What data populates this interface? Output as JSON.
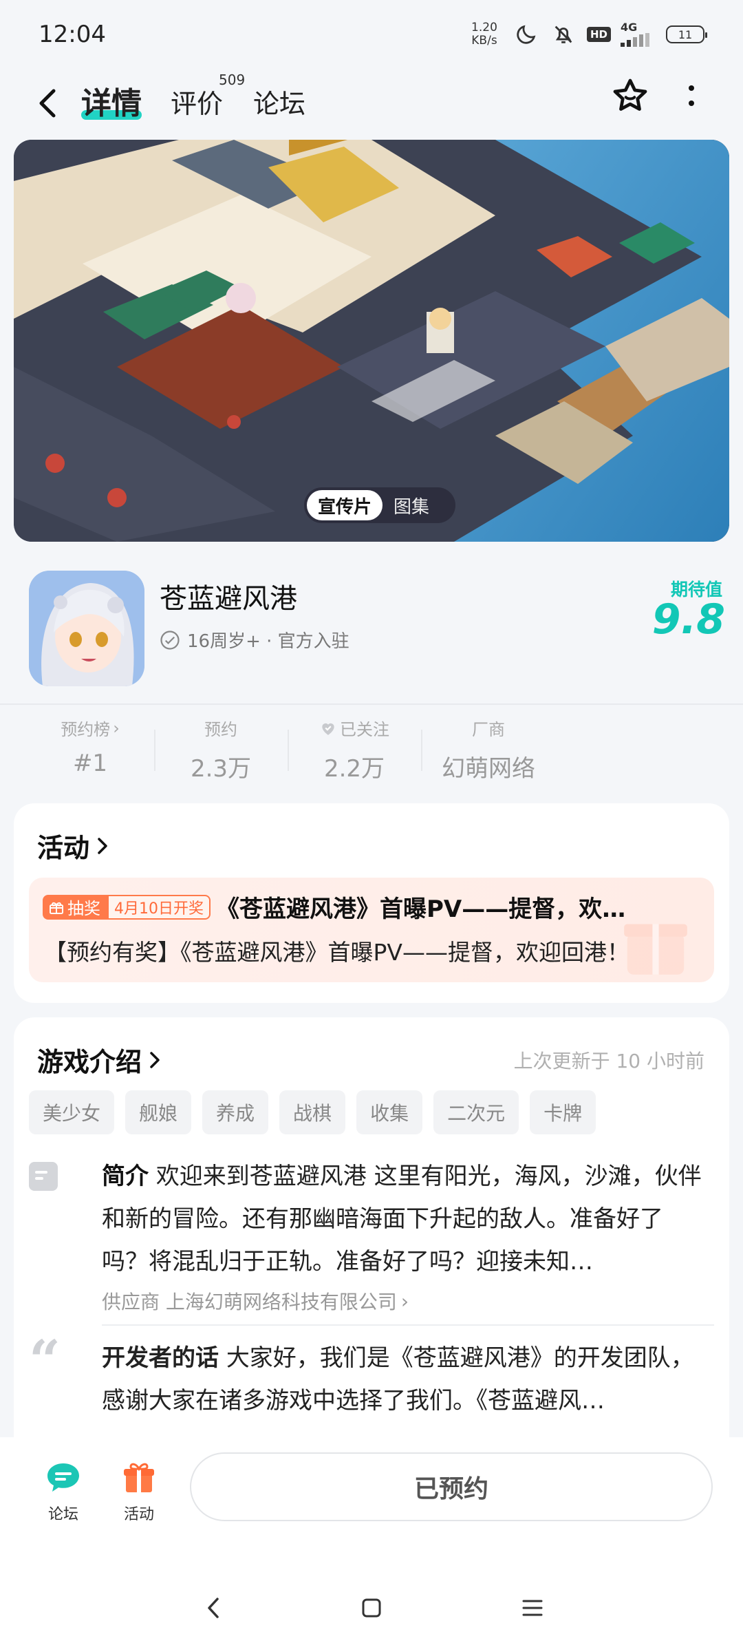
{
  "status_bar": {
    "time": "12:04",
    "net_speed_value": "1.20",
    "net_speed_unit": "KB/s",
    "network": "4G",
    "hd": "HD",
    "battery": "11"
  },
  "header": {
    "tabs": [
      {
        "label": "详情",
        "active": true
      },
      {
        "label": "评价",
        "count": "509"
      },
      {
        "label": "论坛"
      }
    ]
  },
  "hero": {
    "pill_active": "宣传片",
    "pill_other": "图集"
  },
  "app": {
    "name": "苍蓝避风港",
    "meta": "16周岁+ · 官方入驻",
    "expect_label": "期待值",
    "expect_value": "9.8"
  },
  "stats": [
    {
      "label": "预约榜",
      "value": "#1"
    },
    {
      "label": "预约",
      "value": "2.3万"
    },
    {
      "label": "已关注",
      "value": "2.2万"
    },
    {
      "label": "厂商",
      "value": "幻萌网络"
    }
  ],
  "activity": {
    "section_title": "活动",
    "badge": "抽奖",
    "date": "4月10日开奖",
    "title": "《苍蓝避风港》首曝PV——提督，欢…",
    "subtitle": "【预约有奖】《苍蓝避风港》首曝PV——提督，欢迎回港！"
  },
  "intro": {
    "section_title": "游戏介绍",
    "updated": "上次更新于 10 小时前",
    "tags": [
      "美少女",
      "舰娘",
      "养成",
      "战棋",
      "收集",
      "二次元",
      "卡牌"
    ],
    "summary_label": "简介",
    "summary": "欢迎来到苍蓝避风港 这里有阳光，海风，沙滩，伙伴和新的冒险。还有那幽暗海面下升起的敌人。准备好了吗？将混乱归于正轨。准备好了吗？迎接未知…",
    "supplier": "供应商 上海幻萌网络科技有限公司",
    "dev_label": "开发者的话",
    "dev_text": "大家好，我们是《苍蓝避风港》的开发团队，感谢大家在诸多游戏中选择了我们。《苍蓝避风…"
  },
  "bottom_bar": {
    "forum": "论坛",
    "activity": "活动",
    "reserved": "已预约"
  },
  "colors": {
    "accent": "#12c7b6",
    "tab_underline": "#21d3c4",
    "lottery": "#ff7a4a"
  }
}
